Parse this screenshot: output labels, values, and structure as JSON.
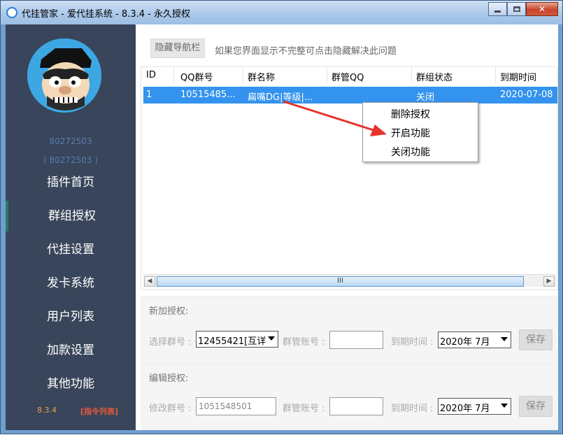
{
  "window": {
    "title": "代挂管家 - 爱代挂系统 - 8.3.4 - 永久授权",
    "controls": [
      "minimize",
      "maximize",
      "close"
    ]
  },
  "sidebar": {
    "account_id": "80272503",
    "account_id_paren": "( 80272503 )",
    "items": [
      {
        "label": "插件首页"
      },
      {
        "label": "群组授权",
        "active": true
      },
      {
        "label": "代挂设置"
      },
      {
        "label": "发卡系统"
      },
      {
        "label": "用户列表"
      },
      {
        "label": "加款设置"
      },
      {
        "label": "其他功能"
      }
    ],
    "version": "8.3.4",
    "command_list": "[指令列表]"
  },
  "toolbar": {
    "hide_nav_button": "隐藏导航栏",
    "hint": "如果您界面显示不完整可点击隐藏解决此问题"
  },
  "table": {
    "columns": [
      "ID",
      "QQ群号",
      "群名称",
      "群管QQ",
      "群组状态",
      "到期时间"
    ],
    "rows": [
      {
        "id": "1",
        "group_no": "10515485...",
        "group_name": "扁嘴DG|等级|...",
        "admin_qq": "",
        "status": "关闭",
        "expiry": "2020-07-08"
      }
    ],
    "scroll_thumb_label": "III"
  },
  "context_menu": {
    "items": [
      {
        "label": "删除授权"
      },
      {
        "label": "开启功能"
      },
      {
        "label": "关闭功能"
      }
    ]
  },
  "new_auth": {
    "title": "新加授权:",
    "group_label": "选择群号 :",
    "group_value": "12455421[互详",
    "admin_label": "群管账号 :",
    "admin_value": "",
    "expiry_label": "到期时间 :",
    "expiry_value": "2020年 7月",
    "save": "保存"
  },
  "edit_auth": {
    "title": "编辑授权:",
    "group_label": "修改群号 :",
    "group_value": "1051548501",
    "admin_label": "群管账号 :",
    "admin_value": "",
    "expiry_label": "到期时间 :",
    "expiry_value": "2020年 7月",
    "save": "保存"
  },
  "colors": {
    "sidebar_bg": "#38455a",
    "selection": "#3393ee",
    "annotation_arrow": "#e8322e",
    "version_text": "#e8a048",
    "command_text": "#e8583a"
  }
}
